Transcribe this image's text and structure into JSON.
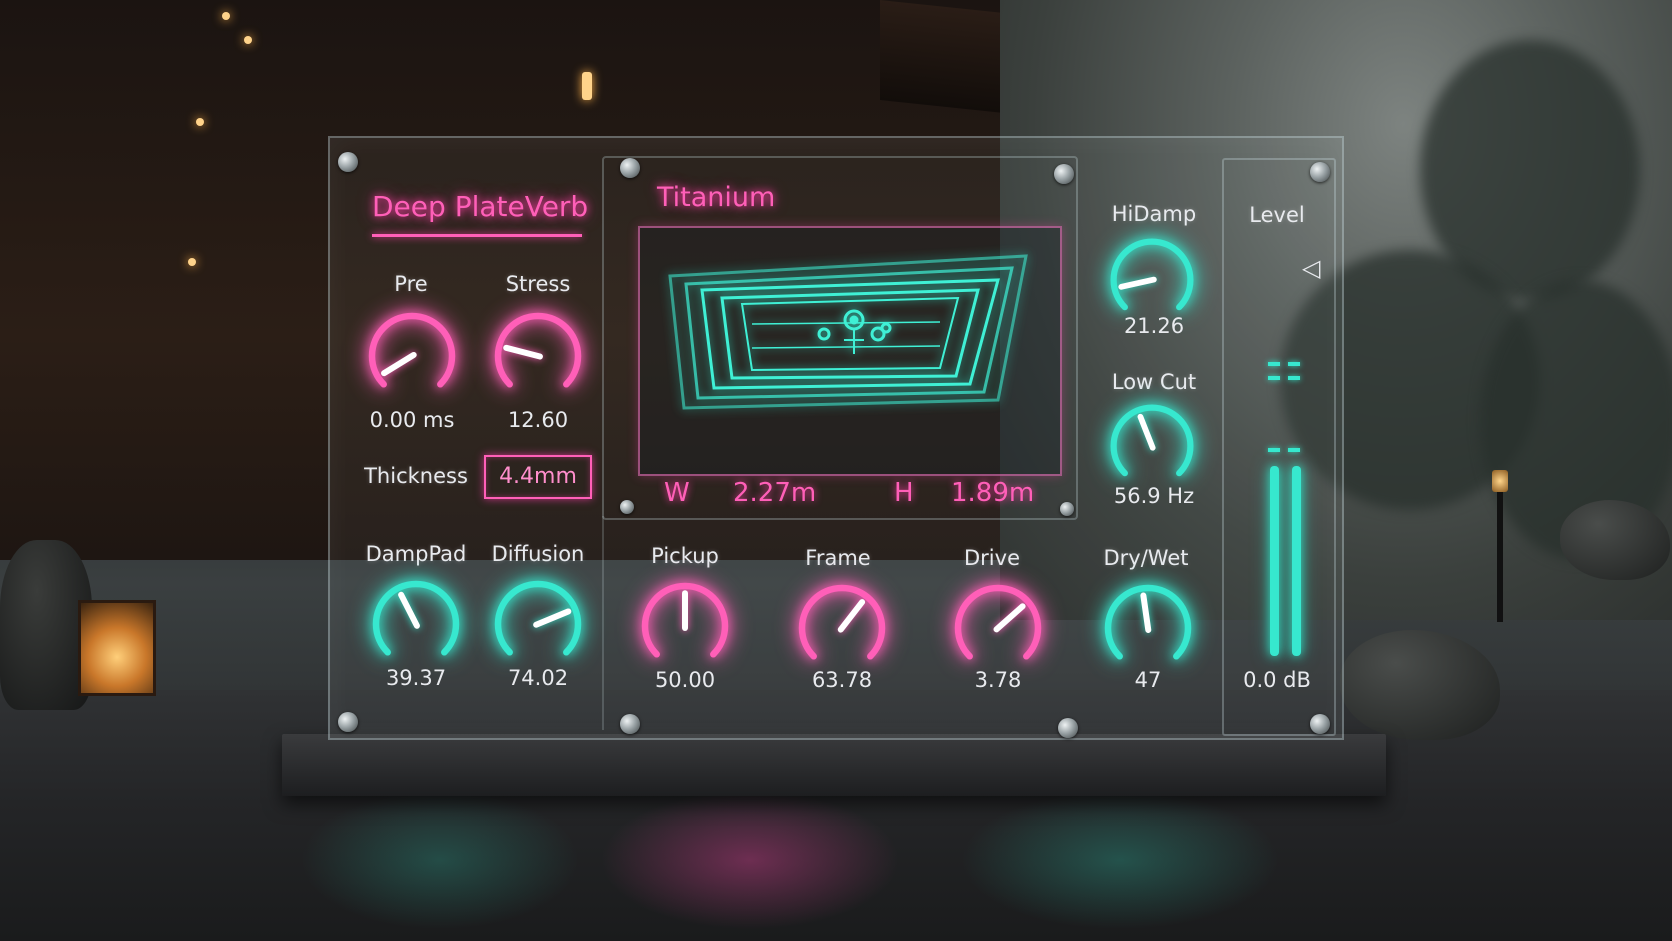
{
  "plugin": {
    "title": "Deep PlateVerb",
    "material": "Titanium",
    "accent_pink": "#ff5fb8",
    "accent_teal": "#37e8cf"
  },
  "left": {
    "pre": {
      "label": "Pre",
      "value": "0.00 ms",
      "fraction": 0.05
    },
    "stress": {
      "label": "Stress",
      "value": "12.60",
      "fraction": 0.22
    },
    "thickness": {
      "label": "Thickness",
      "value": "4.4mm"
    },
    "damppad": {
      "label": "DampPad",
      "value": "39.37",
      "fraction": 0.4
    },
    "diffusion": {
      "label": "Diffusion",
      "value": "74.02",
      "fraction": 0.75
    }
  },
  "display": {
    "w_label": "W",
    "w_value": "2.27m",
    "h_label": "H",
    "h_value": "1.89m"
  },
  "bottom": {
    "pickup": {
      "label": "Pickup",
      "value": "50.00",
      "fraction": 0.5
    },
    "frame": {
      "label": "Frame",
      "value": "63.78",
      "fraction": 0.64
    },
    "drive": {
      "label": "Drive",
      "value": "3.78",
      "fraction": 0.68
    },
    "drywet": {
      "label": "Dry/Wet",
      "value": "47",
      "fraction": 0.47
    }
  },
  "right": {
    "hidamp": {
      "label": "HiDamp",
      "value": "21.26",
      "fraction": 0.12
    },
    "lowcut": {
      "label": "Low Cut",
      "value": "56.9 Hz",
      "fraction": 0.42
    }
  },
  "level": {
    "label": "Level",
    "value": "0.0 dB",
    "icon": "triangle-left-icon"
  }
}
